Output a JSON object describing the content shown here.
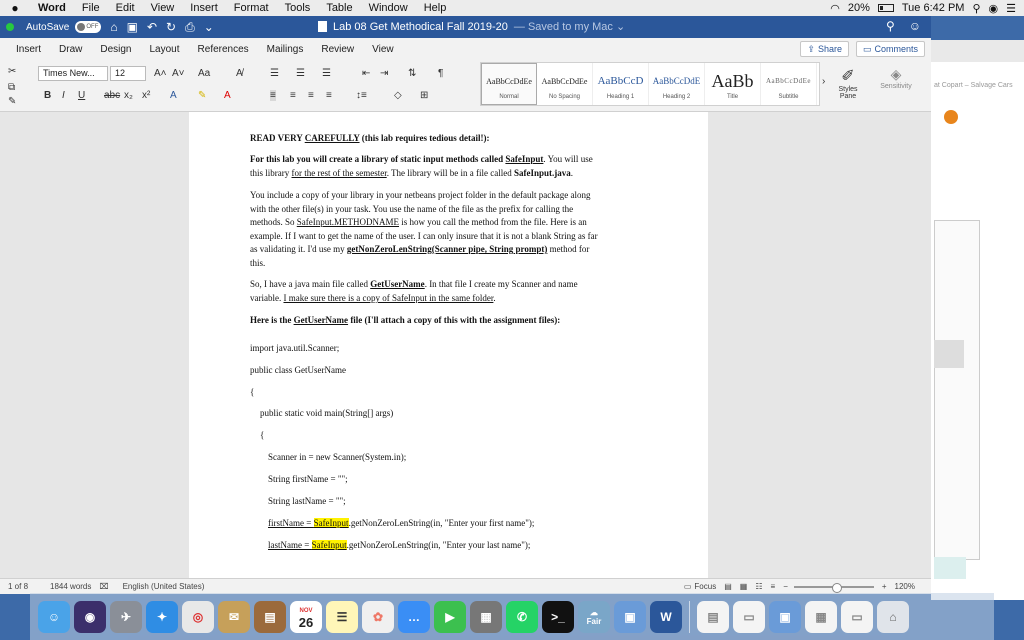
{
  "menubar": {
    "apple": "",
    "app": "Word",
    "items": [
      "File",
      "Edit",
      "View",
      "Insert",
      "Format",
      "Tools",
      "Table",
      "Window",
      "Help"
    ],
    "battery": "20%",
    "clock": "Tue 6:42 PM"
  },
  "titlebar": {
    "autosave_label": "AutoSave",
    "autosave_state": "OFF",
    "doc_name": "Lab 08 Get Methodical Fall 2019-20",
    "saved_status": "— Saved to my Mac ⌄"
  },
  "tabs": [
    "Insert",
    "Draw",
    "Design",
    "Layout",
    "References",
    "Mailings",
    "Review",
    "View"
  ],
  "share_label": "Share",
  "comments_label": "Comments",
  "ribbon": {
    "font": "Times New...",
    "size": "12",
    "styles": [
      {
        "preview": "AaBbCcDdEe",
        "name": "Normal"
      },
      {
        "preview": "AaBbCcDdEe",
        "name": "No Spacing"
      },
      {
        "preview": "AaBbCcD",
        "name": "Heading 1"
      },
      {
        "preview": "AaBbCcDdE",
        "name": "Heading 2"
      },
      {
        "preview": "AaBb",
        "name": "Title"
      },
      {
        "preview": "AaBbCcDdEe",
        "name": "Subtitle"
      }
    ],
    "styles_pane": "Styles Pane",
    "sensitivity": "Sensitivity"
  },
  "doc": {
    "p1_a": "READ VERY ",
    "p1_b": "CAREFULLY",
    "p1_c": "  (this lab requires tedious detail!):",
    "p2_l1_a": "For this lab you will create a library of static input methods called ",
    "p2_l1_b": "SafeInput",
    "p2_l1_c": ".  You will use",
    "p2_l2_a": "this library ",
    "p2_l2_b": "for the rest of the semester",
    "p2_l2_c": ". The library will be in a file called ",
    "p2_l2_d": "SafeInput.java",
    "p2_l2_e": ".",
    "p3_l1": "You include a copy of your library in your netbeans project folder in the default package along",
    "p3_l2": "with the other file(s) in your task.  You use the name of the file as the prefix for calling the",
    "p3_l3_a": "methods.  So ",
    "p3_l3_b": "SafeInput.METHODNAME",
    "p3_l3_c": " is how you call the method from the file. Here is an",
    "p3_l4": "example. If I want to get the name of the user. I can only insure that it is not a blank String as far",
    "p3_l5_a": "as validating it. I'd use my ",
    "p3_l5_b": "getNonZeroLenString(Scanner pipe, String prompt)",
    "p3_l5_c": " method for",
    "p3_l6": "this.",
    "p4_l1_a": "So, I have a java main file called ",
    "p4_l1_b": "GetUserName",
    "p4_l1_c": ". In that file I create my Scanner and name",
    "p4_l2_a": "variable.  ",
    "p4_l2_b": "I make sure there is a copy of SafeInput in the same folder",
    "p4_l2_c": ".",
    "p5_a": "Here is the ",
    "p5_b": "GetUserName",
    "p5_c": " file (I'll attach a copy of this with the assignment files):",
    "code1": "import java.util.Scanner;",
    "code2": "public class GetUserName",
    "code3": "{",
    "code4": "public static void main(String[] args)",
    "code5": "{",
    "code6": "Scanner in = new Scanner(System.in);",
    "code7": "String firstName = \"\";",
    "code8": "String lastName = \"\";",
    "code9_a": "firstName = ",
    "code9_b": "SafeInput",
    "code9_c": ".getNonZeroLenString(in, \"Enter your first name\");",
    "code10_a": "lastName = ",
    "code10_b": "SafeInput",
    "code10_c": ".getNonZeroLenString(in, \"Enter your last name\");"
  },
  "status": {
    "page": "1 of 8",
    "words": "1844 words",
    "language": "English (United States)",
    "focus": "Focus",
    "zoom": "120%"
  },
  "side": {
    "text": "at Copart – Salvage Cars"
  },
  "dock": {
    "calendar_month": "NOV",
    "calendar_day": "26",
    "weather_label": "Fair",
    "word_letter": "W"
  }
}
